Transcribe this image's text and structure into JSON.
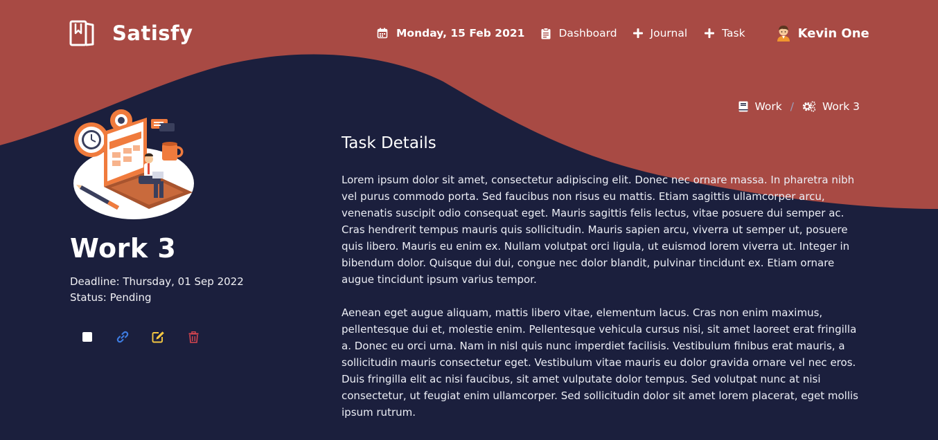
{
  "header": {
    "brand": "Satisfy",
    "nav": {
      "date": "Monday, 15 Feb 2021",
      "dashboard": "Dashboard",
      "journal": "Journal",
      "task": "Task",
      "user": "Kevin One"
    }
  },
  "breadcrumb": {
    "parent": "Work",
    "separator": "/",
    "current": "Work 3"
  },
  "task": {
    "title": "Work 3",
    "deadline": "Deadline: Thursday, 01 Sep 2022",
    "status": "Status: Pending",
    "completed": false
  },
  "details": {
    "heading": "Task Details",
    "paragraphs": [
      "Lorem ipsum dolor sit amet, consectetur adipiscing elit. Donec nec ornare massa. In pharetra nibh vel purus commodo porta. Sed faucibus non risus eu mattis. Etiam sagittis ullamcorper arcu, venenatis suscipit odio consequat eget. Mauris sagittis felis lectus, vitae posuere dui semper ac. Cras hendrerit tempus mauris quis sollicitudin. Mauris sapien arcu, viverra ut semper ut, posuere quis libero. Mauris eu enim ex. Nullam volutpat orci ligula, ut euismod lorem viverra ut. Integer in bibendum dolor. Quisque dui dui, congue nec dolor blandit, pulvinar tincidunt ex. Etiam ornare augue tincidunt ipsum varius tempor.",
      "Aenean eget augue aliquam, mattis libero vitae, elementum lacus. Cras non enim maximus, pellentesque dui et, molestie enim. Pellentesque vehicula cursus nisi, sit amet laoreet erat fringilla a. Donec eu orci urna. Nam in nisl quis nunc imperdiet facilisis. Vestibulum finibus erat mauris, a sollicitudin mauris consectetur eget. Vestibulum vitae mauris eu dolor gravida ornare vel nec eros. Duis fringilla elit ac nisi faucibus, sit amet vulputate dolor tempus. Sed volutpat nunc at nisi consectetur, ut feugiat enim ullamcorper. Sed sollicitudin dolor sit amet lorem placerat, eget mollis ipsum rutrum."
    ]
  },
  "icons": {
    "brand": "book-icon",
    "date": "calendar-icon",
    "dashboard": "clipboard-icon",
    "journal": "plus-icon",
    "task": "plus-icon",
    "user": "person-avatar-icon",
    "breadcrumb_parent": "book-icon",
    "breadcrumb_current": "gears-icon",
    "actions": [
      "checkbox",
      "link-icon",
      "edit-icon",
      "trash-icon"
    ]
  },
  "colors": {
    "background": "#1b1f3d",
    "header_wave": "#a84a44",
    "link_icon": "#3d7be0",
    "edit_icon": "#f5c842",
    "trash_icon": "#d9454f",
    "text": "#ffffff"
  }
}
